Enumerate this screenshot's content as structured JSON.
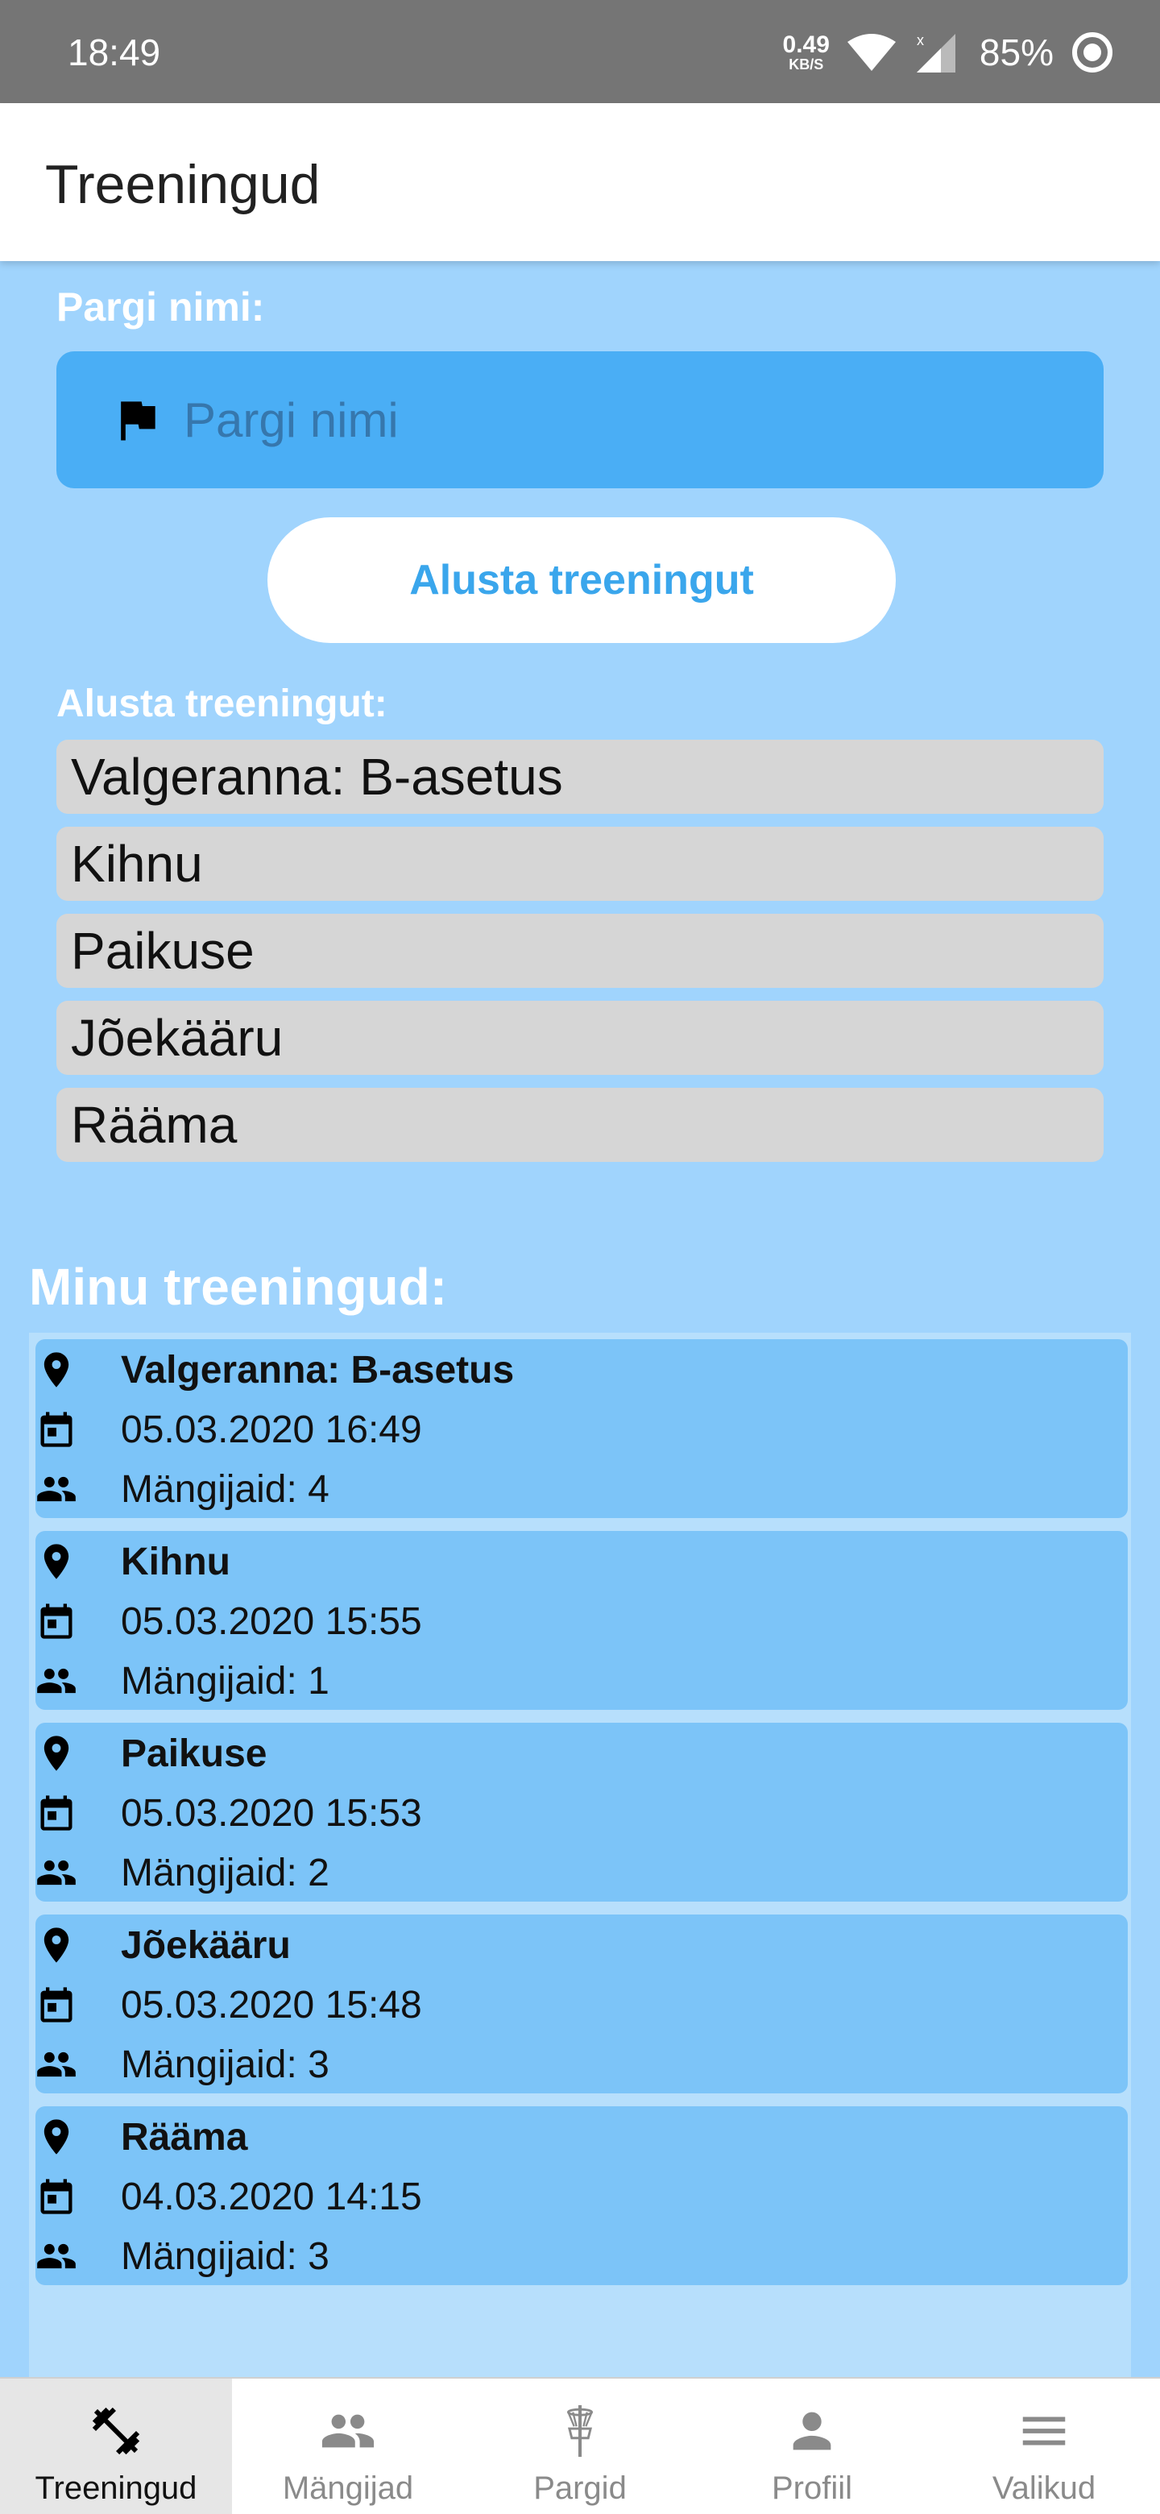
{
  "status": {
    "time": "18:49",
    "net_speed": "0.49",
    "net_unit": "KB/S",
    "battery": "85%"
  },
  "app_bar": {
    "title": "Treeningud"
  },
  "form": {
    "park_label": "Pargi nimi:",
    "park_placeholder": "Pargi nimi",
    "start_button": "Alusta treeningut",
    "start_label": "Alusta treeningut:",
    "suggestions": [
      "Valgeranna: B-asetus",
      "Kihnu",
      "Paikuse",
      "Jõekääru",
      "Rääma"
    ]
  },
  "my_trainings": {
    "title": "Minu treeningud:",
    "items": [
      {
        "park": "Valgeranna: B-asetus",
        "date": "05.03.2020 16:49",
        "players": "Mängijaid: 4"
      },
      {
        "park": "Kihnu",
        "date": "05.03.2020 15:55",
        "players": "Mängijaid: 1"
      },
      {
        "park": "Paikuse",
        "date": "05.03.2020 15:53",
        "players": "Mängijaid: 2"
      },
      {
        "park": "Jõekääru",
        "date": "05.03.2020 15:48",
        "players": "Mängijaid: 3"
      },
      {
        "park": "Rääma",
        "date": "04.03.2020 14:15",
        "players": "Mängijaid: 3"
      }
    ]
  },
  "bottom_nav": {
    "items": [
      {
        "label": "Treeningud",
        "icon": "dumbbell-icon",
        "active": true
      },
      {
        "label": "Mängijad",
        "icon": "people-icon"
      },
      {
        "label": "Pargid",
        "icon": "disc-basket-icon"
      },
      {
        "label": "Profiil",
        "icon": "person-icon"
      },
      {
        "label": "Valikud",
        "icon": "menu-icon"
      }
    ]
  },
  "colors": {
    "background": "#a0d4fd",
    "input_bg": "#4aaef5",
    "card_bg": "#7cc4f8",
    "accent_text": "#3aa6ec",
    "suggestion_bg": "#d6d6d6"
  }
}
